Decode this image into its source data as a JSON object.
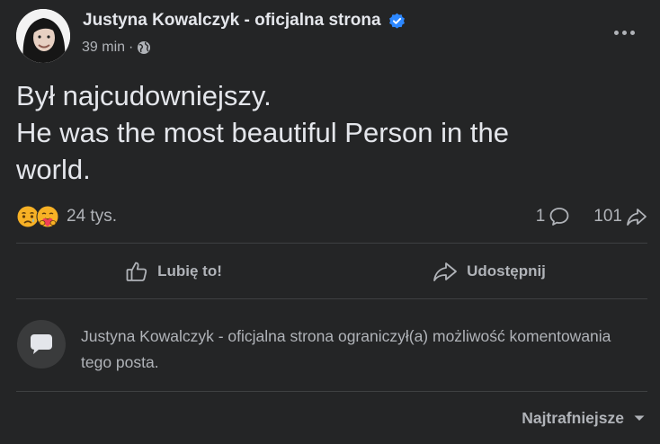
{
  "post": {
    "author": "Justyna Kowalczyk - oficjalna strona",
    "time": "39 min",
    "dot": "·",
    "text_lines": [
      "Był najcudowniejszy.",
      "He was the most beautiful Person in the",
      "world."
    ]
  },
  "stats": {
    "reactions": "24 tys.",
    "reaction_icons": [
      "sad-face-icon",
      "care-hug-icon"
    ],
    "comments": "1",
    "shares": "101"
  },
  "actions": {
    "like_label": "Lubię to!",
    "share_label": "Udostępnij"
  },
  "notice": {
    "text": "Justyna Kowalczyk - oficjalna strona ograniczył(a) możliwość komentowania tego posta."
  },
  "sort": {
    "label": "Najtrafniejsze"
  },
  "colors": {
    "background": "#242526",
    "primary_text": "#e4e6eb",
    "secondary_text": "#b0b3b8",
    "verified": "#2d88ff",
    "divider": "#3e4042"
  }
}
